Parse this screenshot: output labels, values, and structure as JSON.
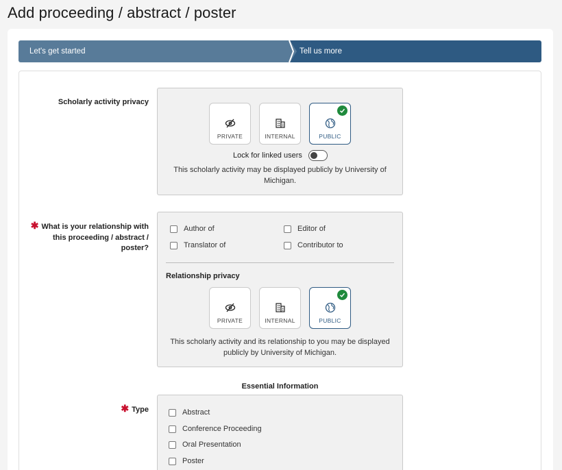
{
  "page": {
    "title": "Add proceeding / abstract / poster"
  },
  "stepper": {
    "steps": [
      {
        "label": "Let's get started"
      },
      {
        "label": "Tell us more"
      }
    ]
  },
  "scholarly_privacy": {
    "label": "Scholarly activity privacy",
    "options": [
      {
        "label": "PRIVATE",
        "icon": "eye-slash-icon",
        "selected": false
      },
      {
        "label": "INTERNAL",
        "icon": "building-icon",
        "selected": false
      },
      {
        "label": "PUBLIC",
        "icon": "globe-icon",
        "selected": true
      }
    ],
    "lock_label": "Lock for linked users",
    "lock_on": false,
    "note": "This scholarly activity may be displayed publicly by University of Michigan."
  },
  "relationship": {
    "required_marker": "✱",
    "label": "What is your relationship with this proceeding / abstract / poster?",
    "options": [
      {
        "label": "Author of",
        "checked": false
      },
      {
        "label": "Editor of",
        "checked": false
      },
      {
        "label": "Translator of",
        "checked": false
      },
      {
        "label": "Contributor to",
        "checked": false
      }
    ],
    "privacy_heading": "Relationship privacy",
    "privacy_options": [
      {
        "label": "PRIVATE",
        "icon": "eye-slash-icon",
        "selected": false
      },
      {
        "label": "INTERNAL",
        "icon": "building-icon",
        "selected": false
      },
      {
        "label": "PUBLIC",
        "icon": "globe-icon",
        "selected": true
      }
    ],
    "note": "This scholarly activity and its relationship to you may be displayed publicly by University of Michigan."
  },
  "essential": {
    "heading": "Essential Information",
    "type_label": "Type",
    "required_marker": "✱",
    "type_options": [
      {
        "label": "Abstract",
        "checked": false
      },
      {
        "label": "Conference Proceeding",
        "checked": false
      },
      {
        "label": "Oral Presentation",
        "checked": false
      },
      {
        "label": "Poster",
        "checked": false
      }
    ]
  },
  "colors": {
    "step_inactive": "#587b99",
    "step_active": "#2e5a82",
    "selected_border": "#2e5a82",
    "check_green": "#1f8a3c",
    "required_red": "#c8102e"
  }
}
